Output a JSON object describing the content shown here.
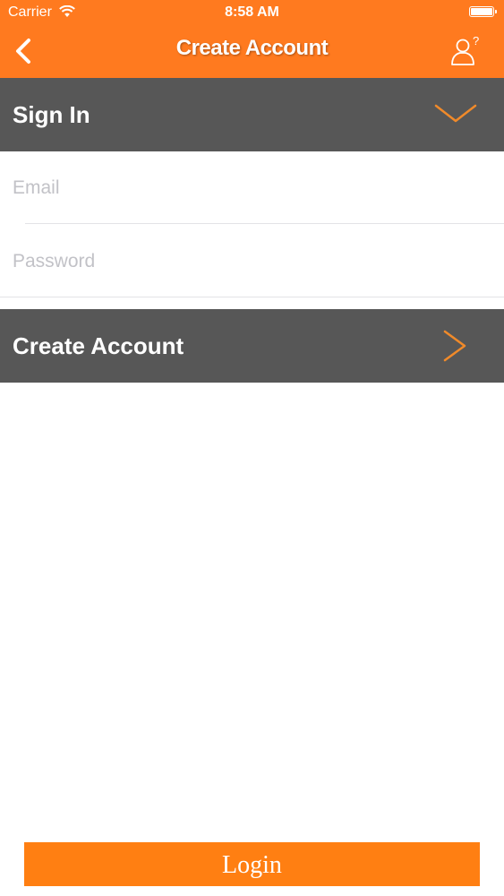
{
  "status_bar": {
    "carrier": "Carrier",
    "time": "8:58 AM"
  },
  "nav": {
    "title": "Create Account"
  },
  "sign_in_section": {
    "label": "Sign In"
  },
  "form": {
    "email_placeholder": "Email",
    "email_value": "",
    "password_placeholder": "Password",
    "password_value": ""
  },
  "create_account_section": {
    "label": "Create Account"
  },
  "login_button": {
    "label": "Login"
  },
  "colors": {
    "accent": "#ff7a1f",
    "section_bar": "#575757",
    "chevron": "#f08a2a"
  },
  "icons": [
    "wifi-icon",
    "battery-icon",
    "back-arrow-icon",
    "user-help-icon",
    "chevron-down-icon",
    "chevron-right-icon"
  ]
}
